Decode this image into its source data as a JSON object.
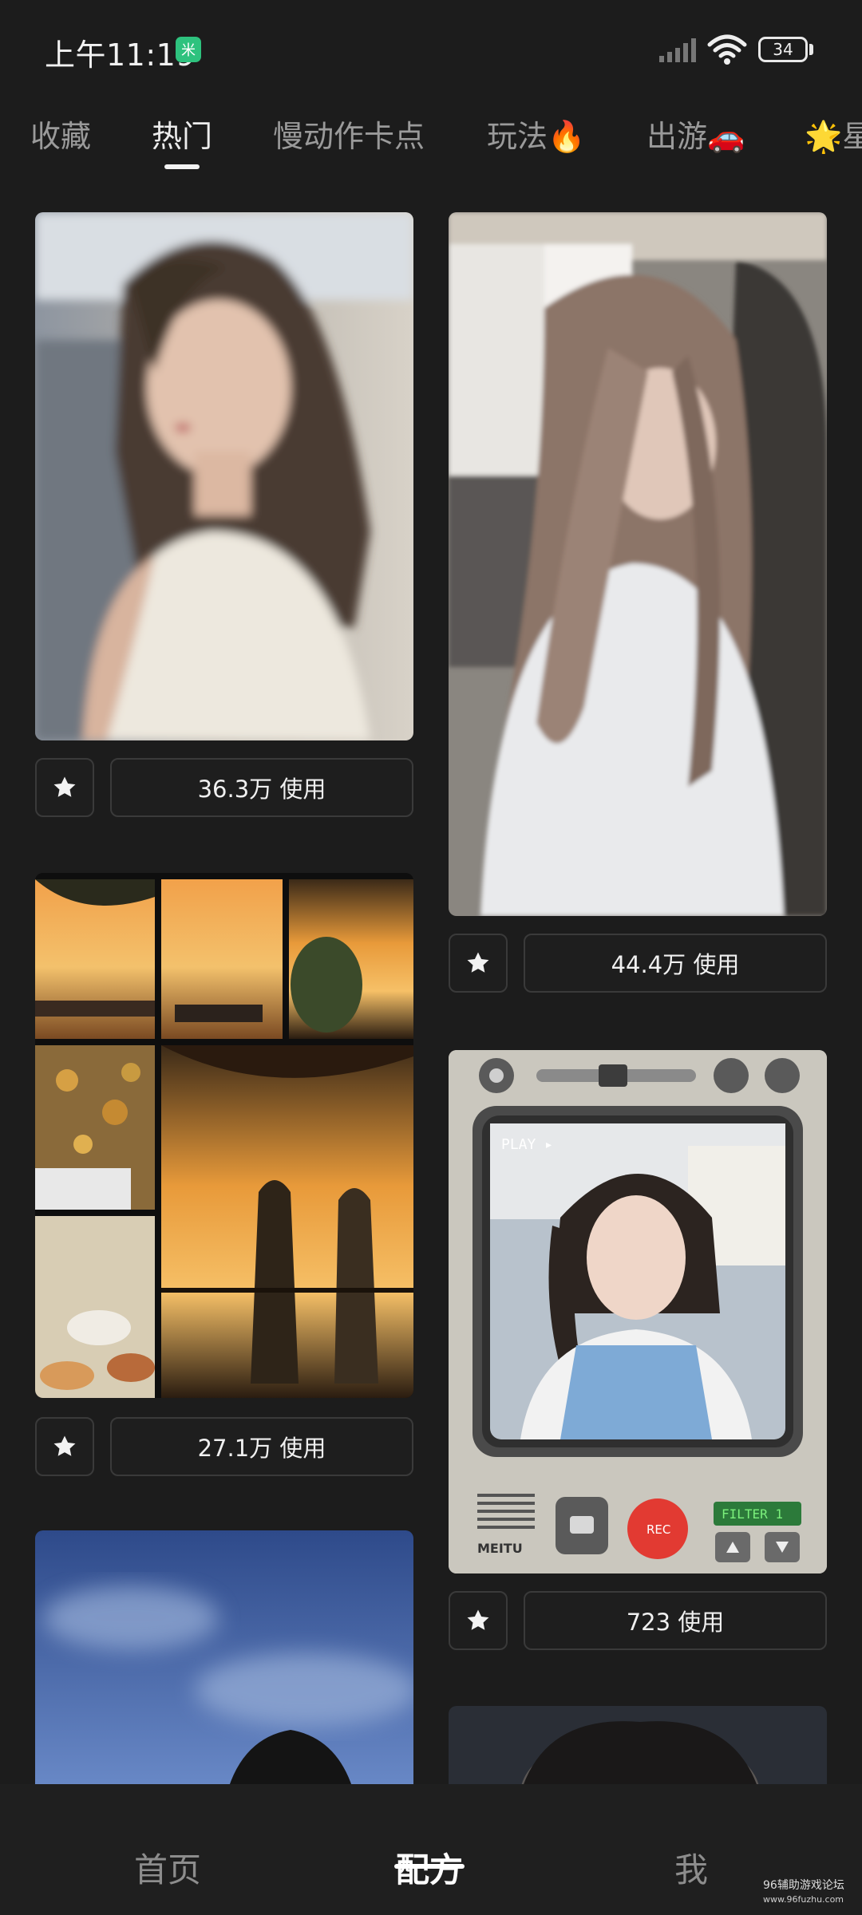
{
  "status_bar": {
    "time": "上午11:19",
    "app_badge": "米",
    "battery": "34"
  },
  "tabs": [
    {
      "label": "收藏"
    },
    {
      "label": "热门",
      "active": true
    },
    {
      "label": "慢动作卡点"
    },
    {
      "label": "玩法🔥"
    },
    {
      "label": "出游🚗"
    },
    {
      "label": "🌟星"
    }
  ],
  "cards": [
    {
      "usage": "36.3万 使用",
      "image": "portrait-woman-white-tank"
    },
    {
      "usage": "44.4万 使用",
      "image": "girl-long-hair-car"
    },
    {
      "usage": "27.1万 使用",
      "image": "sunset-lake-collage"
    },
    {
      "usage": "723 使用",
      "image": "retro-camera-frame-girl"
    },
    {
      "image": "blue-sky-portrait"
    },
    {
      "image": "dark-portrait"
    }
  ],
  "camera_frame": {
    "play": "PLAY ▸",
    "rec": "REC",
    "filter": "FILTER 1",
    "brand": "MEITU"
  },
  "bottom_nav": [
    {
      "label": "首页"
    },
    {
      "label": "配方",
      "active": true
    },
    {
      "label": "我"
    }
  ],
  "watermark": {
    "line1": "96辅助游戏论坛",
    "line2": "www.96fuzhu.com"
  },
  "colors": {
    "background": "#1c1c1c",
    "text": "#e8e8e8",
    "muted": "#9a9a9a",
    "border": "#3a3a3a"
  }
}
